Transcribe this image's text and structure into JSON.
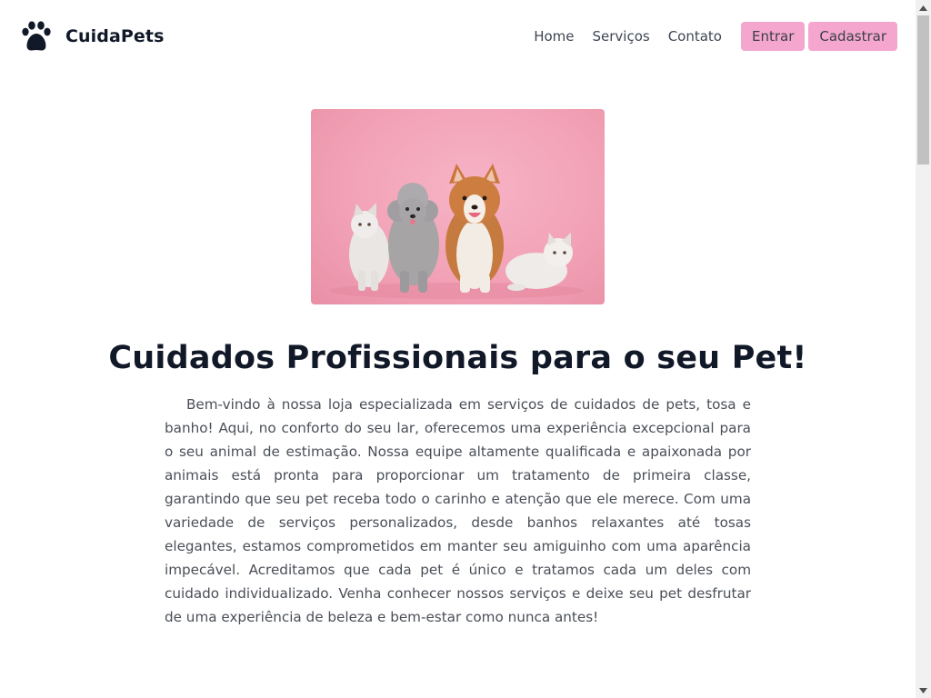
{
  "brand": {
    "name": "CuidaPets",
    "icon": "paw-icon",
    "color": "#111827"
  },
  "nav": {
    "links": [
      "Home",
      "Serviços",
      "Contato"
    ],
    "login_label": "Entrar",
    "signup_label": "Cadastrar",
    "button_color": "#f4a6cf"
  },
  "hero": {
    "image_subject": "pets-photo"
  },
  "main": {
    "title": "Cuidados Profissionais para o seu Pet!",
    "intro": "Bem-vindo à nossa loja especializada em serviços de cuidados de pets, tosa e banho! Aqui, no conforto do seu lar, oferecemos uma experiência excepcional para o seu animal de estimação. Nossa equipe altamente qualificada e apaixonada por animais está pronta para proporcionar um tratamento de primeira classe, garantindo que seu pet receba todo o carinho e atenção que ele merece. Com uma variedade de serviços personalizados, desde banhos relaxantes até tosas elegantes, estamos comprometidos em manter seu amiguinho com uma aparência impecável. Acreditamos que cada pet é único e tratamos cada um deles com cuidado individualizado. Venha conhecer nossos serviços e deixe seu pet desfrutar de uma experiência de beleza e bem-estar como nunca antes!"
  }
}
